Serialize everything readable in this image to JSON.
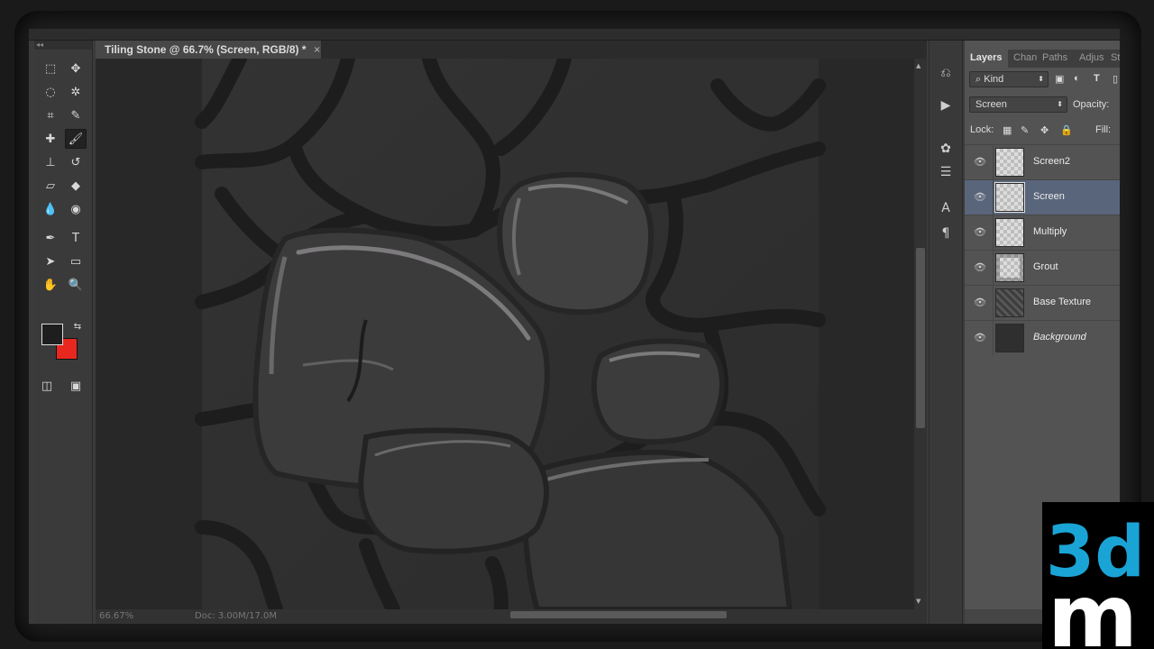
{
  "document": {
    "tab_title": "Tiling Stone @ 66.7% (Screen, RGB/8) *",
    "close_glyph": "×",
    "zoom": "66.67%",
    "doc_size": "Doc: 3.00M/17.0M"
  },
  "tools": [
    {
      "name": "marquee-tool-icon",
      "glyph": "⬚"
    },
    {
      "name": "move-tool-icon",
      "glyph": "✥"
    },
    {
      "name": "lasso-tool-icon",
      "glyph": "◌"
    },
    {
      "name": "magic-wand-tool-icon",
      "glyph": "✲"
    },
    {
      "name": "crop-tool-icon",
      "glyph": "⌗"
    },
    {
      "name": "eyedropper-tool-icon",
      "glyph": "✎"
    },
    {
      "name": "healing-brush-tool-icon",
      "glyph": "✚"
    },
    {
      "name": "brush-tool-icon",
      "glyph": "🖌"
    },
    {
      "name": "clone-stamp-tool-icon",
      "glyph": "⊥"
    },
    {
      "name": "history-brush-tool-icon",
      "glyph": "↺"
    },
    {
      "name": "eraser-tool-icon",
      "glyph": "▱"
    },
    {
      "name": "paint-bucket-tool-icon",
      "glyph": "◆"
    },
    {
      "name": "blur-tool-icon",
      "glyph": "💧"
    },
    {
      "name": "sponge-tool-icon",
      "glyph": "◉"
    },
    {
      "name": "pen-tool-icon",
      "glyph": "✒"
    },
    {
      "name": "type-tool-icon",
      "glyph": "T"
    },
    {
      "name": "path-selection-tool-icon",
      "glyph": "➤"
    },
    {
      "name": "rectangle-tool-icon",
      "glyph": "▭"
    },
    {
      "name": "hand-tool-icon",
      "glyph": "✋"
    },
    {
      "name": "zoom-tool-icon",
      "glyph": "🔍"
    }
  ],
  "colors": {
    "foreground": "#1e1e1e",
    "background": "#e8281e",
    "selected_layer": "#59657a",
    "logo_accent": "#1aa4d6"
  },
  "strip_icons": [
    "history-icon",
    "actions-icon",
    "brush-presets-icon",
    "adjustments-icon",
    "character-icon",
    "paragraph-icon"
  ],
  "layers_panel": {
    "tabs": [
      "Layers",
      "Chan",
      "Paths",
      "Adjus",
      "St"
    ],
    "filter_kind": "Kind",
    "filter_search_glyph": "⌕",
    "blend_mode": "Screen",
    "opacity_label": "Opacity:",
    "lock_label": "Lock:",
    "fill_label": "Fill:",
    "layers": [
      {
        "name": "Screen2",
        "thumb": "checker",
        "selected": false,
        "italic": false
      },
      {
        "name": "Screen",
        "thumb": "checker",
        "selected": true,
        "italic": false
      },
      {
        "name": "Multiply",
        "thumb": "checker",
        "selected": false,
        "italic": false
      },
      {
        "name": "Grout",
        "thumb": "grout",
        "selected": false,
        "italic": false
      },
      {
        "name": "Base Texture",
        "thumb": "texture",
        "selected": false,
        "italic": false
      },
      {
        "name": "Background",
        "thumb": "dark",
        "selected": false,
        "italic": true
      }
    ]
  },
  "logo": {
    "line1": "3d",
    "line2": "m"
  }
}
